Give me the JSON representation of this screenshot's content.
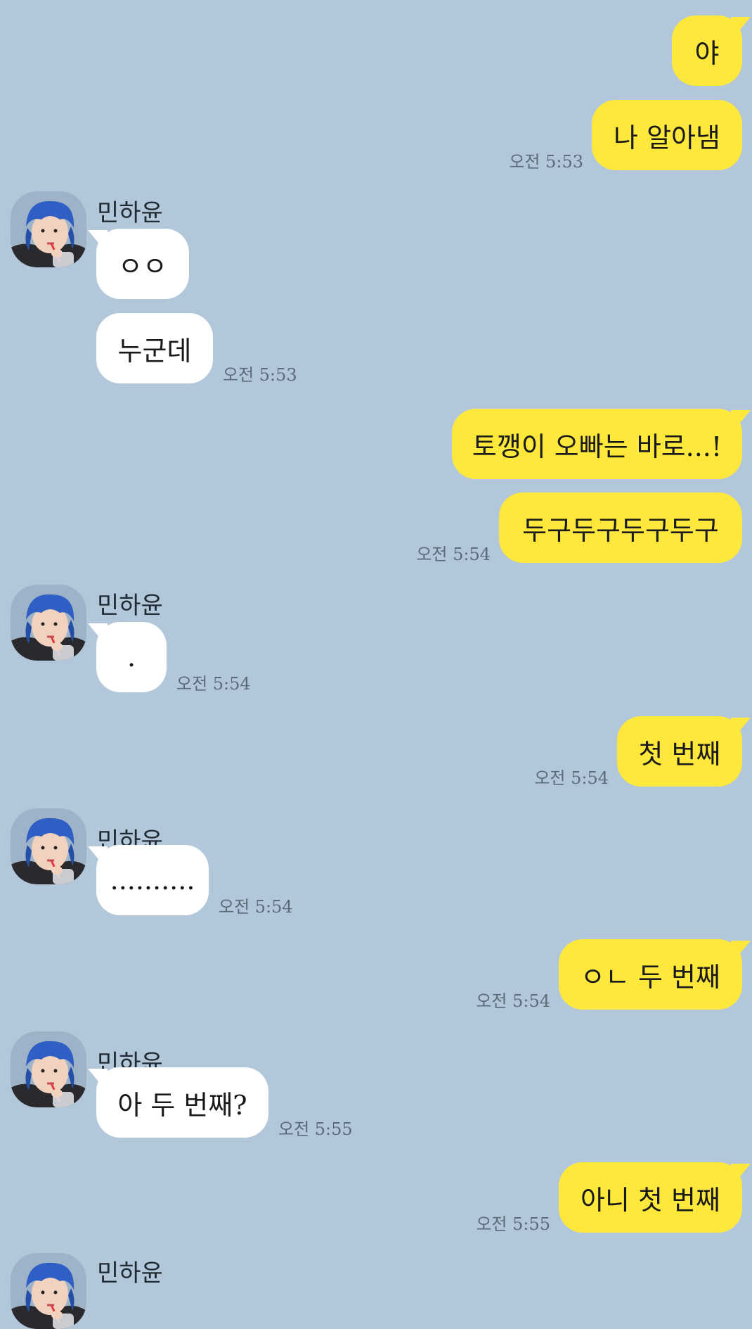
{
  "contact": {
    "name": "민하윤",
    "avatar_icon": "profile-avatar-blue-hair"
  },
  "colors": {
    "background": "#b2c7da",
    "outgoing": "#fee83c",
    "incoming": "#ffffff"
  },
  "messages": [
    {
      "side": "me",
      "text": "야"
    },
    {
      "side": "me",
      "text": "나 알아냄",
      "time": "오전 5:53"
    },
    {
      "side": "them",
      "text": "ㅇㅇ",
      "sender": "민하윤"
    },
    {
      "side": "them",
      "text": "누군데",
      "time": "오전 5:53"
    },
    {
      "side": "me",
      "text": "토깽이 오빠는 바로...!"
    },
    {
      "side": "me",
      "text": "두구두구두구두구",
      "time": "오전 5:54"
    },
    {
      "side": "them",
      "text": ".",
      "sender": "민하윤",
      "time": "오전 5:54"
    },
    {
      "side": "me",
      "text": "첫 번째",
      "time": "오전 5:54"
    },
    {
      "side": "them",
      "text": "..........",
      "sender": "민하윤",
      "time": "오전 5:54"
    },
    {
      "side": "me",
      "text": "ㅇㄴ 두 번째",
      "time": "오전 5:54"
    },
    {
      "side": "them",
      "text": "아 두 번째?",
      "sender": "민하윤",
      "time": "오전 5:55"
    },
    {
      "side": "me",
      "text": "아니 첫 번째",
      "time": "오전 5:55"
    },
    {
      "side": "them",
      "sender": "민하윤"
    }
  ]
}
